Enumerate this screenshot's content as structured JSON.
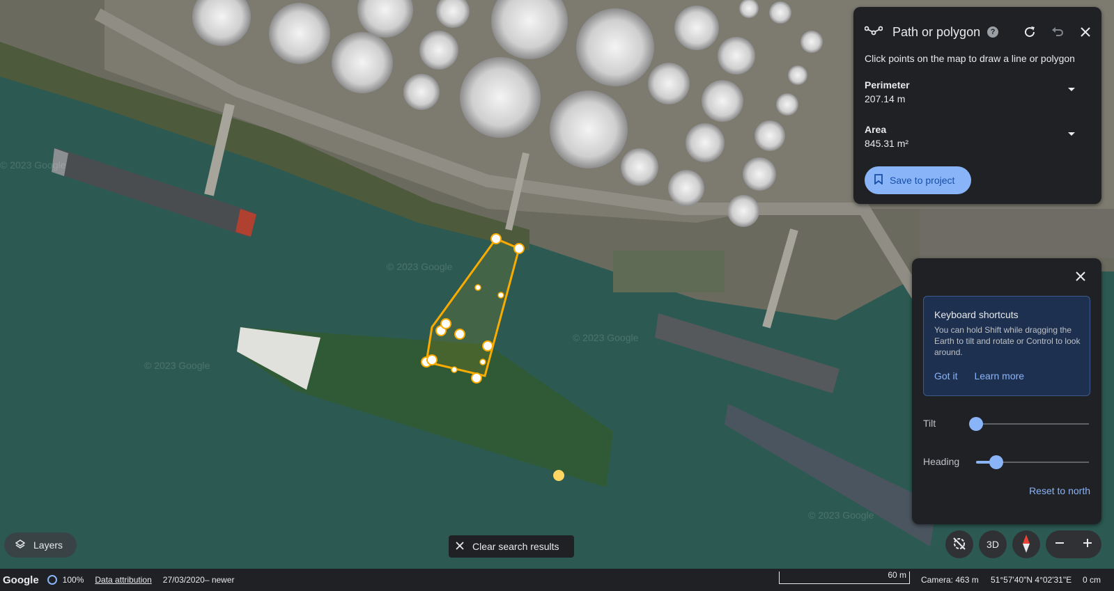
{
  "path_panel": {
    "title": "Path or polygon",
    "help_icon": "?",
    "instruction": "Click points on the map to draw a line or polygon",
    "perimeter_label": "Perimeter",
    "perimeter_value": "207.14 m",
    "area_label": "Area",
    "area_value": "845.31 m²",
    "save_label": "Save to project"
  },
  "navigation_panel": {
    "shortcuts_title": "Keyboard shortcuts",
    "shortcuts_text": "You can hold Shift while dragging the Earth to tilt and rotate or Control to look around.",
    "got_it": "Got it",
    "learn_more": "Learn more",
    "tilt_label": "Tilt",
    "tilt_level": 0.0,
    "heading_label": "Heading",
    "heading_level": 0.18,
    "reset_label": "Reset to north"
  },
  "controls": {
    "layers_label": "Layers",
    "clear_label": "Clear search results",
    "three_d_label": "3D"
  },
  "footer": {
    "logo": "Google",
    "loading_percent": "100%",
    "attribution": "Data attribution",
    "imagery_date": "27/03/2020– newer",
    "scale_label": "60 m",
    "camera": "Camera: 463 m",
    "coordinates": "51°57'40\"N 4°02'31\"E",
    "elevation": "0 cm"
  },
  "map": {
    "watermark": "© 2023 Google"
  },
  "colors": {
    "accent": "#8ab4f8",
    "polygon": "#f9ab00",
    "water": "#2c5a52",
    "panel": "#202124"
  }
}
